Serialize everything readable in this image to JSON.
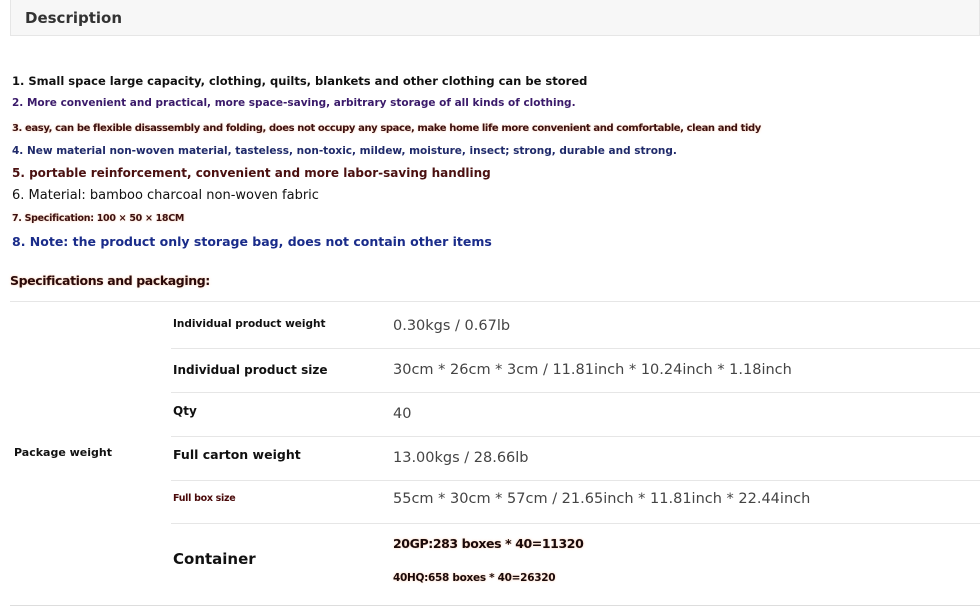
{
  "header": {
    "title": "Description"
  },
  "description_lines": [
    "1. Small space large capacity, clothing, quilts, blankets and other clothing can be stored",
    "2. More convenient and practical, more space-saving, arbitrary storage of all kinds of clothing.",
    "3. easy, can be flexible disassembly and folding, does not occupy any space, make home life more convenient and comfortable, clean and tidy",
    "4. New material non-woven material, tasteless, non-toxic, mildew, moisture, insect; strong, durable and strong.",
    "5. portable reinforcement, convenient and more labor-saving handling",
    "6. Material: bamboo charcoal non-woven fabric",
    "7. Specification: 100 × 50 × 18CM",
    "8. Note: the product only storage bag, does not contain other items"
  ],
  "specs": {
    "title": "Specifications and packaging:",
    "group_label": "Package weight",
    "rows": [
      {
        "label": "Individual product weight",
        "value": "0.30kgs / 0.67lb"
      },
      {
        "label": "Individual product size",
        "value": "30cm * 26cm * 3cm / 11.81inch * 10.24inch * 1.18inch"
      },
      {
        "label": "Qty",
        "value": "40"
      },
      {
        "label": "Full carton weight",
        "value": "13.00kgs / 28.66lb"
      },
      {
        "label": "Full box size",
        "value": "55cm * 30cm * 57cm / 21.65inch * 11.81inch * 22.44inch"
      }
    ],
    "container": {
      "label": "Container",
      "values": [
        "20GP:283 boxes * 40=11320",
        "40HQ:658 boxes * 40=26320"
      ]
    }
  }
}
